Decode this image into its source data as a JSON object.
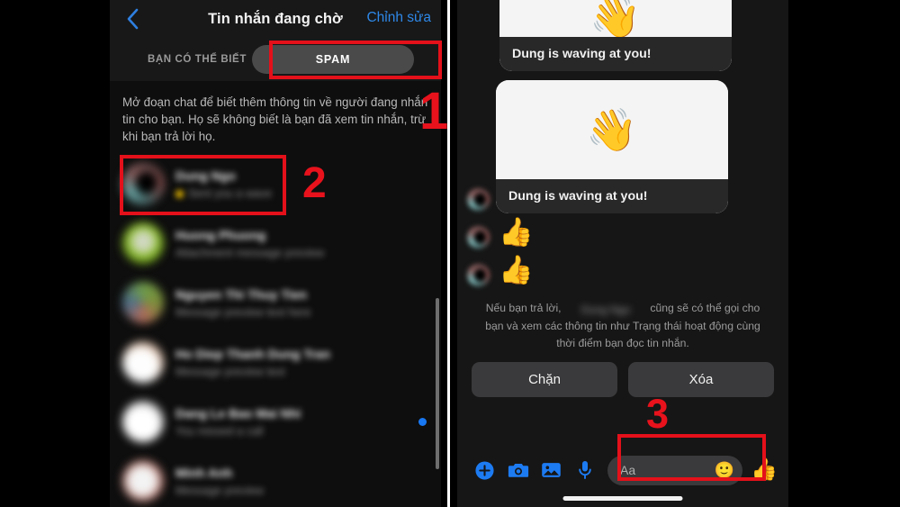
{
  "left_panel": {
    "nav": {
      "back_icon": "chevron-left-icon",
      "title": "Tin nhắn đang chờ",
      "edit_label": "Chỉnh sửa"
    },
    "tabs": {
      "inactive_label": "BẠN CÓ THỂ BIẾT",
      "active_label": "SPAM"
    },
    "description": "Mở đoạn chat để biết thêm thông tin về người đang nhắn tin cho bạn. Họ sẽ không biết là bạn đã xem tin nhắn, trừ khi bạn trả lời họ.",
    "requests": [
      {
        "name": "Dung Ngo",
        "preview": "Sent you a wave",
        "blurred": true,
        "has_yellow_dot": true,
        "unread": false
      },
      {
        "name": "Huong Phuong",
        "preview": "Attachment message preview",
        "blurred": true,
        "has_yellow_dot": false,
        "unread": false
      },
      {
        "name": "Nguyen Thi Thuy Tien",
        "preview": "Message preview text here",
        "blurred": true,
        "has_yellow_dot": false,
        "unread": false
      },
      {
        "name": "Ho Diep Thanh Dung Tran",
        "preview": "Message preview text",
        "blurred": true,
        "has_yellow_dot": false,
        "unread": false
      },
      {
        "name": "Dang Le Bao Mai Nhi",
        "preview": "You missed a call",
        "blurred": true,
        "has_yellow_dot": false,
        "unread": true
      },
      {
        "name": "Minh Anh",
        "preview": "Message preview",
        "blurred": true,
        "has_yellow_dot": false,
        "unread": false
      }
    ],
    "scrollbar_visible": true
  },
  "right_panel": {
    "messages": [
      {
        "type": "wave-card",
        "emoji": "wave-emoji",
        "caption": "Dung is waving at you!",
        "clipped": true
      },
      {
        "type": "wave-card",
        "emoji": "wave-emoji",
        "caption": "Dung is waving at you!",
        "clipped": false
      },
      {
        "type": "thumb",
        "icon": "thumbs-up-icon"
      },
      {
        "type": "thumb",
        "icon": "thumbs-up-icon"
      }
    ],
    "reply_note_before": "Nếu bạn trả lời,",
    "reply_note_blurred_name": "Dung Ngo",
    "reply_note_after": "cũng sẽ có thể gọi cho bạn và xem các thông tin như Trạng thái hoạt động cùng thời điểm bạn đọc tin nhắn.",
    "actions": {
      "block_label": "Chặn",
      "delete_label": "Xóa"
    },
    "composer": {
      "plus_icon": "plus-circle-icon",
      "camera_icon": "camera-icon",
      "gallery_icon": "photo-icon",
      "mic_icon": "microphone-icon",
      "placeholder": "Aa",
      "emoji_icon": "smiley-icon",
      "send_like_icon": "thumbs-up-icon"
    }
  },
  "annotations": {
    "step1": "1",
    "step2": "2",
    "step3": "3"
  },
  "colors": {
    "accent_blue": "#1d7bf2",
    "annotation_red": "#e4101a",
    "panel_bg": "#0e0e0e",
    "chat_bg": "#161616"
  }
}
